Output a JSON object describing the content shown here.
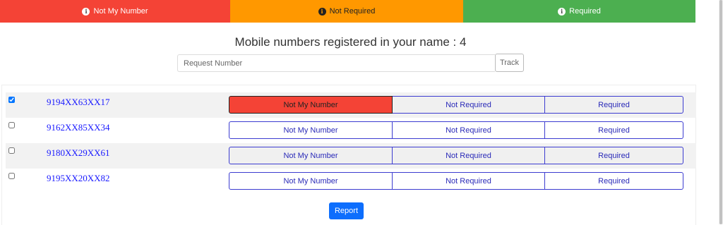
{
  "legend": [
    {
      "label": "Not My Number",
      "color": "#f44336"
    },
    {
      "label": "Not Required",
      "color": "#ff9800"
    },
    {
      "label": "Required",
      "color": "#4caf50"
    }
  ],
  "title": "Mobile numbers registered in your name : 4",
  "search": {
    "placeholder": "Request Number",
    "value": "",
    "track_label": "Track"
  },
  "options": [
    "Not My Number",
    "Not Required",
    "Required"
  ],
  "rows": [
    {
      "number": "9194XX63XX17",
      "checked": true,
      "selected": "Not My Number"
    },
    {
      "number": "9162XX85XX34",
      "checked": false,
      "selected": ""
    },
    {
      "number": "9180XX29XX61",
      "checked": false,
      "selected": ""
    },
    {
      "number": "9195XX20XX82",
      "checked": false,
      "selected": ""
    }
  ],
  "report_label": "Report"
}
